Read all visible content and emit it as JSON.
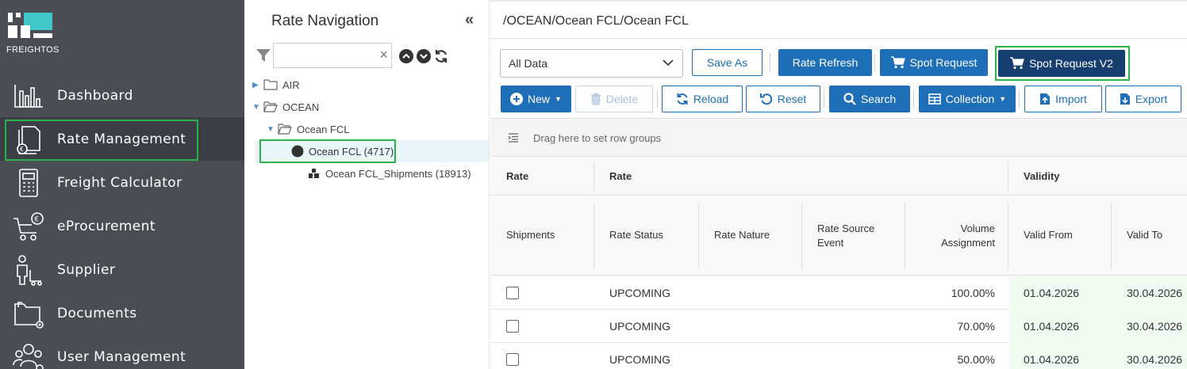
{
  "brand": {
    "name": "FREIGHTOS",
    "accent": "#3fc7c9",
    "highlight": "#2bb24c",
    "primary": "#1e6fb8",
    "dark": "#163f70"
  },
  "sidebar": {
    "items": [
      {
        "label": "Dashboard",
        "icon": "bar-chart-icon"
      },
      {
        "label": "Rate Management",
        "icon": "document-euro-icon",
        "active": true
      },
      {
        "label": "Freight Calculator",
        "icon": "calculator-icon"
      },
      {
        "label": "eProcurement",
        "icon": "cart-euro-icon"
      },
      {
        "label": "Supplier",
        "icon": "person-cart-icon"
      },
      {
        "label": "Documents",
        "icon": "folder-gear-icon"
      },
      {
        "label": "User Management",
        "icon": "users-gear-icon"
      }
    ]
  },
  "rate_nav": {
    "title": "Rate Navigation",
    "collapse": "«",
    "search_placeholder": "",
    "clear": "×",
    "tree": [
      {
        "label": "AIR",
        "level": 0,
        "expanded": false
      },
      {
        "label": "OCEAN",
        "level": 0,
        "expanded": true
      },
      {
        "label": "Ocean FCL",
        "level": 1,
        "expanded": true
      },
      {
        "label": "Ocean FCL (4717)",
        "level": 2,
        "selected": true
      },
      {
        "label": "Ocean FCL_Shipments (18913)",
        "level": 2
      }
    ]
  },
  "main": {
    "breadcrumb": "/OCEAN/Ocean FCL/Ocean FCL",
    "view_select": "All Data",
    "toolbar1": {
      "save_as": "Save As",
      "rate_refresh": "Rate Refresh",
      "spot_request": "Spot Request",
      "spot_request_v2": "Spot Request V2"
    },
    "toolbar2": {
      "new": "New",
      "delete": "Delete",
      "reload": "Reload",
      "reset": "Reset",
      "search": "Search",
      "collection": "Collection",
      "import": "Import",
      "export": "Export"
    },
    "grid": {
      "group_hint": "Drag here to set row groups",
      "group_headers": [
        "Rate",
        "Rate",
        "Validity"
      ],
      "columns": [
        "Shipments",
        "Rate Status",
        "Rate Nature",
        "Rate Source Event",
        "Volume Assignment",
        "Valid From",
        "Valid To"
      ],
      "columns_lines": {
        "rate_source_event": [
          "Rate Source",
          "Event"
        ],
        "volume_assignment": [
          "Volume",
          "Assignment"
        ]
      },
      "rows": [
        {
          "status": "UPCOMING",
          "volume": "100.00%",
          "valid_from": "01.04.2026",
          "valid_to": "30.04.2026"
        },
        {
          "status": "UPCOMING",
          "volume": "70.00%",
          "valid_from": "01.04.2026",
          "valid_to": "30.04.2026"
        },
        {
          "status": "UPCOMING",
          "volume": "50.00%",
          "valid_from": "01.04.2026",
          "valid_to": "30.04.2026"
        }
      ]
    }
  }
}
